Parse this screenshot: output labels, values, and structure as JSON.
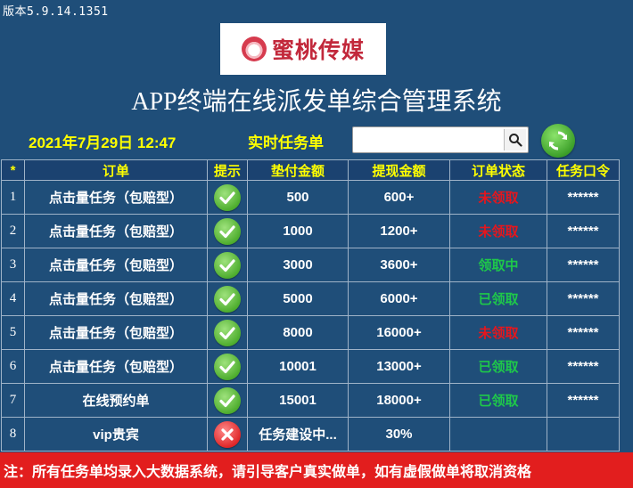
{
  "version": "版本5.9.14.1351",
  "logo": {
    "text": "蜜桃传媒"
  },
  "title": "APP终端在线派发单综合管理系统",
  "datetime": "2021年7月29日 12:47",
  "task_label": "实时任务单",
  "search": {
    "value": "",
    "placeholder": ""
  },
  "colors": {
    "background": "#1f4e79",
    "header_text": "#ffff00",
    "status_red": "#e5161d",
    "status_green": "#1ec84a",
    "notice_bg": "#e21e1e"
  },
  "table": {
    "headers": [
      "*",
      "订单",
      "提示",
      "垫付金额",
      "提现金额",
      "订单状态",
      "任务口令"
    ],
    "rows": [
      {
        "idx": "1",
        "order": "点击量任务（包赔型）",
        "hint": "check-icon",
        "advance": "500",
        "withdraw": "600+",
        "status": "未领取",
        "status_color": "red",
        "code": "******"
      },
      {
        "idx": "2",
        "order": "点击量任务（包赔型）",
        "hint": "check-icon",
        "advance": "1000",
        "withdraw": "1200+",
        "status": "未领取",
        "status_color": "red",
        "code": "******"
      },
      {
        "idx": "3",
        "order": "点击量任务（包赔型）",
        "hint": "check-icon",
        "advance": "3000",
        "withdraw": "3600+",
        "status": "领取中",
        "status_color": "green",
        "code": "******"
      },
      {
        "idx": "4",
        "order": "点击量任务（包赔型）",
        "hint": "check-icon",
        "advance": "5000",
        "withdraw": "6000+",
        "status": "已领取",
        "status_color": "green",
        "code": "******"
      },
      {
        "idx": "5",
        "order": "点击量任务（包赔型）",
        "hint": "check-icon",
        "advance": "8000",
        "withdraw": "16000+",
        "status": "未领取",
        "status_color": "red",
        "code": "******"
      },
      {
        "idx": "6",
        "order": "点击量任务（包赔型）",
        "hint": "check-icon",
        "advance": "10001",
        "withdraw": "13000+",
        "status": "已领取",
        "status_color": "green",
        "code": "******"
      },
      {
        "idx": "7",
        "order": "在线预约单",
        "hint": "check-icon",
        "advance": "15001",
        "withdraw": "18000+",
        "status": "已领取",
        "status_color": "green",
        "code": "******"
      },
      {
        "idx": "8",
        "order": "vip贵宾",
        "hint": "cross-icon",
        "advance": "任务建设中...",
        "withdraw": "30%",
        "status": "",
        "status_color": "",
        "code": ""
      }
    ]
  },
  "notice": "注：所有任务单均录入大数据系统，请引导客户真实做单，如有虚假做单将取消资格"
}
